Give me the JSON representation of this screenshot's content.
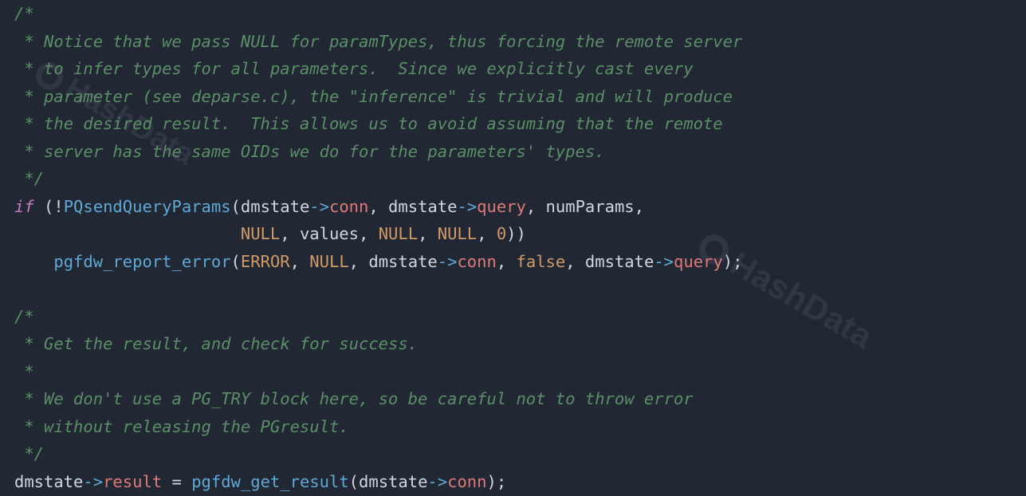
{
  "watermark_text": "HashData",
  "code": {
    "c1_l1": "/*",
    "c1_l2": " * Notice that we pass NULL for paramTypes, thus forcing the remote server",
    "c1_l3": " * to infer types for all parameters.  Since we explicitly cast every",
    "c1_l4": " * parameter (see deparse.c), the \"inference\" is trivial and will produce",
    "c1_l5": " * the desired result.  This allows us to avoid assuming that the remote",
    "c1_l6": " * server has the same OIDs we do for the parameters' types.",
    "c1_l7": " */",
    "kw_if": "if",
    "fn_send": "PQsendQueryParams",
    "id_dmstate": "dmstate",
    "arrow": "->",
    "mb_conn": "conn",
    "mb_query": "query",
    "id_numParams": "numParams",
    "cn_NULL": "NULL",
    "id_values": "values",
    "nu_zero": "0",
    "fn_report": "pgfdw_report_error",
    "cn_ERROR": "ERROR",
    "cn_false": "false",
    "c2_l1": "/*",
    "c2_l2": " * Get the result, and check for success.",
    "c2_l3": " *",
    "c2_l4": " * We don't use a PG_TRY block here, so be careful not to throw error",
    "c2_l5": " * without releasing the PGresult.",
    "c2_l6": " */",
    "mb_result": "result",
    "fn_getresult": "pgfdw_get_result"
  }
}
